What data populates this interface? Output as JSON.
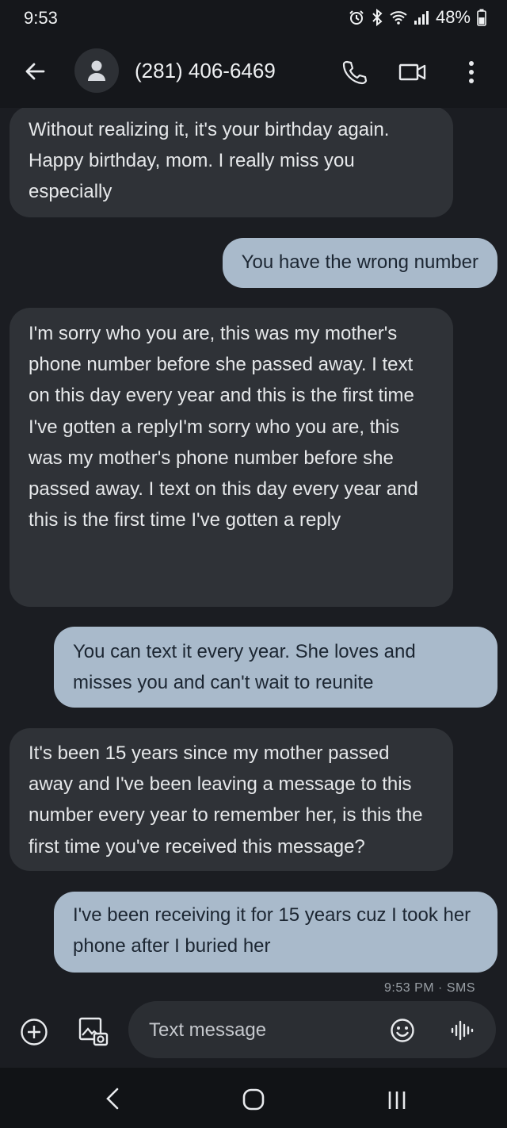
{
  "status_bar": {
    "time": "9:53",
    "battery": "48%",
    "icons": [
      "alarm-icon",
      "bluetooth-icon",
      "wifi-icon",
      "signal-icon",
      "battery-icon"
    ]
  },
  "header": {
    "contact": "(281) 406-6469",
    "icons": [
      "back-arrow-icon",
      "contact-avatar-icon",
      "phone-icon",
      "video-icon",
      "more-icon"
    ]
  },
  "messages": [
    {
      "direction": "incoming",
      "text": "Without realizing it, it's your birthday again. Happy birthday, mom. I really miss you especially"
    },
    {
      "direction": "outgoing",
      "text": "You have the wrong number"
    },
    {
      "direction": "incoming",
      "text": "I'm sorry who you are, this was my mother's phone number before she passed away. I text on this day every year and this is the first time I've gotten a replyI'm sorry who you are, this was my mother's phone number before she passed away. I text on this day every year and this is the first time I've gotten a reply"
    },
    {
      "direction": "outgoing",
      "text": "You can text it every year. She loves and misses you and can't wait to reunite"
    },
    {
      "direction": "incoming",
      "text": "It's been 15 years since my mother passed away and I've been leaving a message to this number every year to remember her, is this the first time you've received this message?"
    },
    {
      "direction": "outgoing",
      "text": "I've been receiving it for 15 years cuz I took her phone after I buried her"
    }
  ],
  "last_message_meta": "9:53 PM · SMS",
  "compose": {
    "placeholder": "Text message",
    "icons": [
      "add-icon",
      "gallery-icon",
      "emoji-icon",
      "voice-icon"
    ]
  },
  "navigation": {
    "icons": [
      "nav-back-icon",
      "nav-home-icon",
      "nav-recents-icon"
    ]
  },
  "colors": {
    "background": "#1b1d22",
    "incoming_bubble": "#2f3237",
    "outgoing_bubble": "#a9bacb",
    "bar": "#15171b"
  }
}
